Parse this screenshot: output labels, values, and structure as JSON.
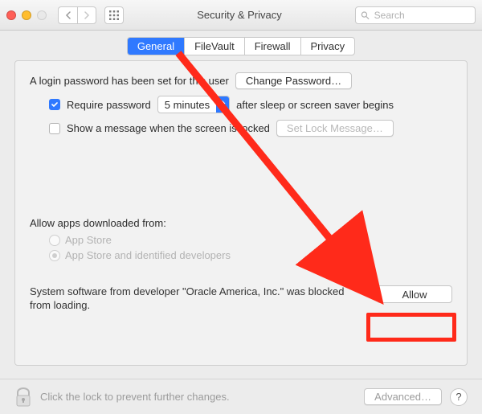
{
  "titlebar": {
    "title": "Security & Privacy",
    "search_placeholder": "Search"
  },
  "tabs": {
    "general": "General",
    "filevault": "FileVault",
    "firewall": "Firewall",
    "privacy": "Privacy"
  },
  "login": {
    "password_set": "A login password has been set for this user",
    "change_btn": "Change Password…",
    "require_label": "Require password",
    "require_delay": "5 minutes",
    "require_after": "after sleep or screen saver begins",
    "show_msg_label": "Show a message when the screen is locked",
    "set_lock_btn": "Set Lock Message…"
  },
  "allow_apps": {
    "heading": "Allow apps downloaded from:",
    "opt1": "App Store",
    "opt2": "App Store and identified developers"
  },
  "blocked": {
    "text": "System software from developer \"Oracle America, Inc.\" was blocked from loading.",
    "allow_btn": "Allow"
  },
  "footer": {
    "lock_text": "Click the lock to prevent further changes.",
    "advanced_btn": "Advanced…",
    "help": "?"
  }
}
